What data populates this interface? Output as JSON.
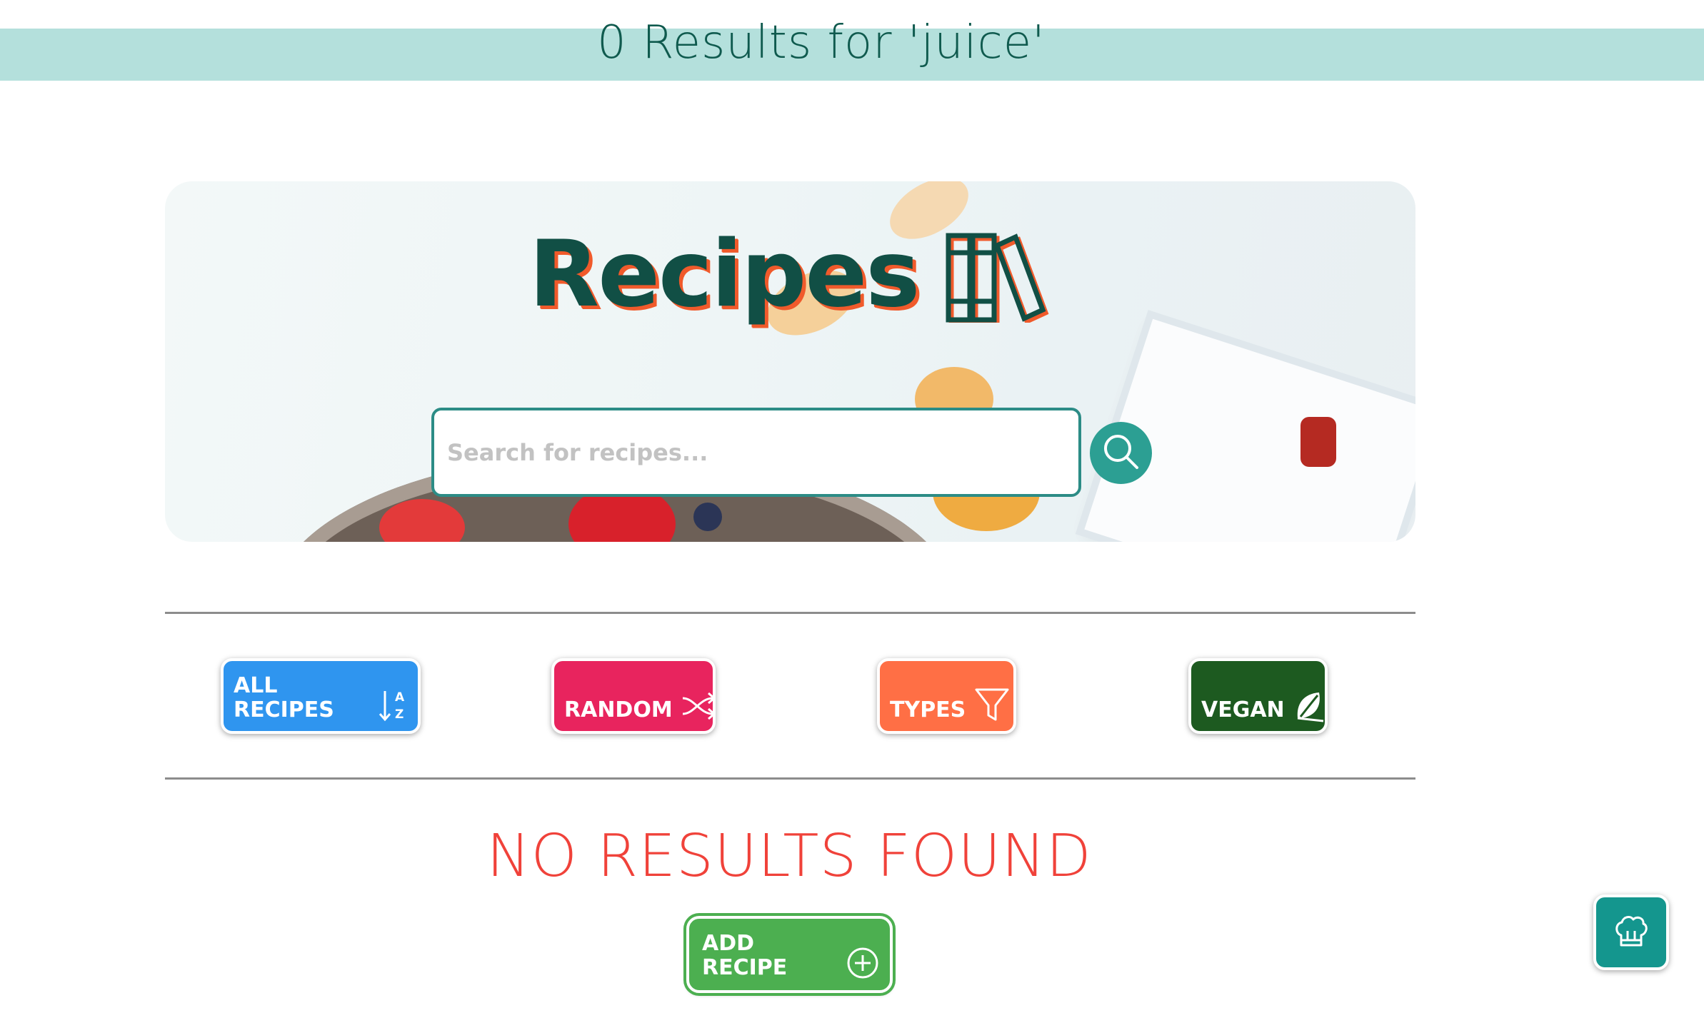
{
  "results_header": {
    "text": "0 Results for 'juice'"
  },
  "hero": {
    "title": "Recipes",
    "title_icon": "books-icon",
    "search": {
      "placeholder": "Search for recipes...",
      "value": "",
      "button_icon": "search-icon"
    }
  },
  "categories": [
    {
      "label": "ALL RECIPES",
      "icon": "sort-alpha-icon",
      "color": "#2f95ef"
    },
    {
      "label": "RANDOM",
      "icon": "shuffle-icon",
      "color": "#e8245e"
    },
    {
      "label": "TYPES",
      "icon": "filter-icon",
      "color": "#ff6f45"
    },
    {
      "label": "VEGAN",
      "icon": "leaf-icon",
      "color": "#1d5a20"
    }
  ],
  "no_results": {
    "text": "NO RESULTS FOUND"
  },
  "add_recipe": {
    "label": "ADD RECIPE",
    "icon": "plus-circle-icon",
    "color": "#4caf50"
  },
  "chef_button": {
    "icon": "chef-hat-icon",
    "color": "#14968e"
  },
  "colors": {
    "header_bar": "#b4e0dc",
    "title_text": "#114f45",
    "title_shadow": "#f05a2b",
    "no_results": "#f0423a",
    "search_border": "#2c8c86",
    "search_button": "#2c9f93"
  }
}
